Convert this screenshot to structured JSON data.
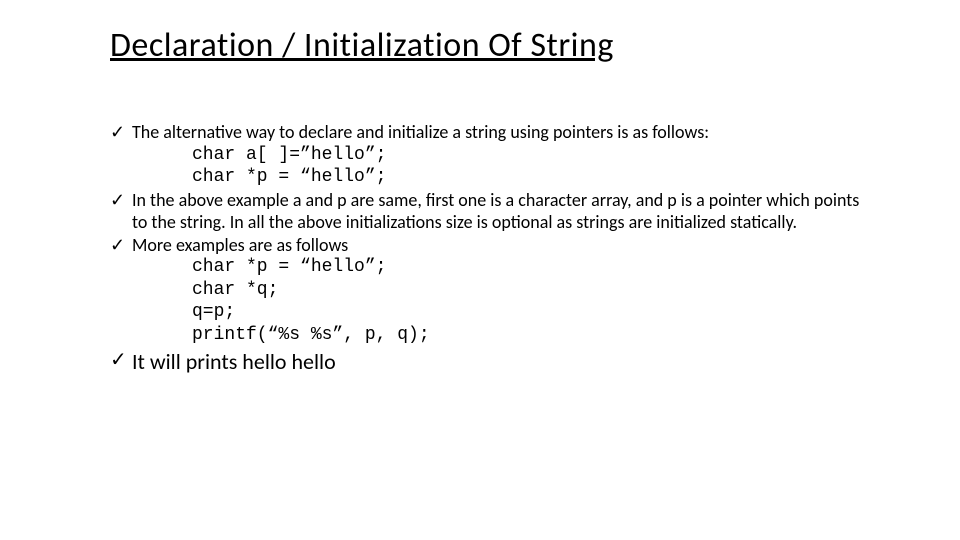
{
  "title": "Declaration / Initialization Of String",
  "bullets": {
    "b1": "The alternative way to declare and initialize a string using pointers is as follows:",
    "code1a": "char a[ ]=”hello”;",
    "code1b": "char *p = “hello”;",
    "b2": "In the above example a and p are same, first one is a character array, and p is a pointer which points to the string. In all the above initializations size is optional as strings are initialized statically.",
    "b3": "More examples are as follows",
    "code2a": "char *p = “hello”;",
    "code2b": "char *q;",
    "code2c": "q=p;",
    "code2d": "printf(“%s %s”, p, q);",
    "b4": "It will prints hello hello"
  },
  "check": "✓"
}
